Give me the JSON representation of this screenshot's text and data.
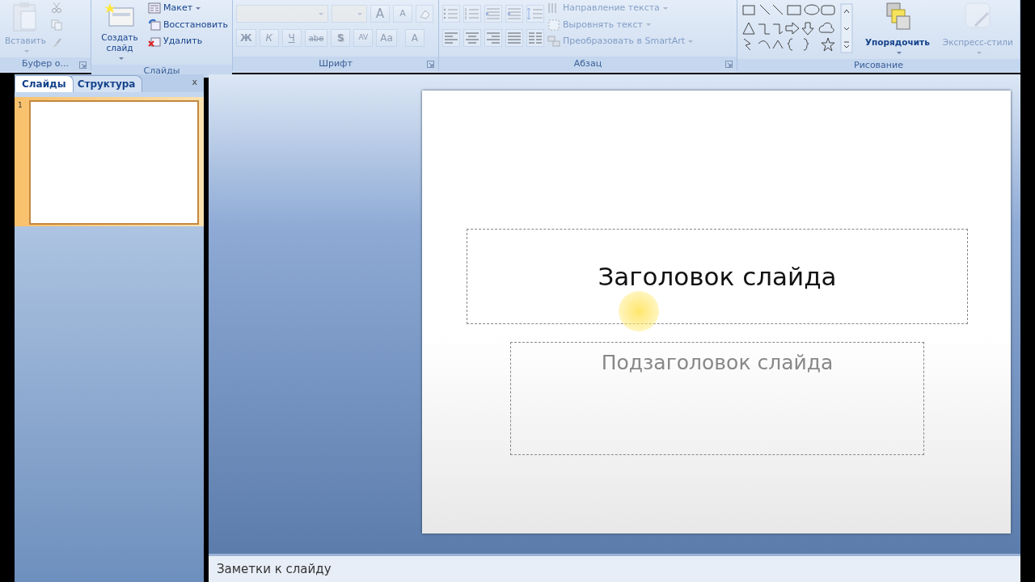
{
  "ribbon": {
    "groups": [
      {
        "kind": "clipboard",
        "label": "Буфер о...",
        "launcher": true,
        "paste": {
          "label": "Вставить",
          "disabled": true
        }
      },
      {
        "kind": "slides",
        "label": "Слайды",
        "new_slide": {
          "label": "Создать слайд",
          "dropdown": true
        },
        "commands": [
          {
            "label": "Макет",
            "dropdown": true
          },
          {
            "label": "Восстановить",
            "dropdown": false
          },
          {
            "label": "Удалить",
            "dropdown": false
          }
        ]
      },
      {
        "kind": "font",
        "label": "Шрифт",
        "launcher": true,
        "disabled": true,
        "size_buttons": [
          "A",
          "A"
        ],
        "format_buttons": [
          "Ж",
          "К",
          "Ч",
          "abe",
          "S",
          "AV",
          "Aa"
        ],
        "color_button": "A"
      },
      {
        "kind": "paragraph",
        "label": "Абзац",
        "launcher": true,
        "disabled": true,
        "commands": [
          {
            "label": "Направление текста"
          },
          {
            "label": "Выровнять текст"
          },
          {
            "label": "Преобразовать в SmartArt"
          }
        ]
      },
      {
        "kind": "drawing",
        "label": "Рисование",
        "commands": [
          {
            "label": "Упорядочить",
            "disabled": false
          },
          {
            "label": "Экспресс-стили",
            "disabled": true
          }
        ]
      }
    ]
  },
  "panel": {
    "tabs": [
      {
        "label": "Слайды",
        "selected": true
      },
      {
        "label": "Структура",
        "selected": false
      }
    ],
    "close": "x",
    "thumbnails": [
      {
        "number": "1",
        "selected": true
      }
    ]
  },
  "slide": {
    "title": "Заголовок слайда",
    "subtitle": "Подзаголовок слайда",
    "cursor_highlight": true
  },
  "notes": {
    "placeholder": "Заметки к слайду"
  }
}
